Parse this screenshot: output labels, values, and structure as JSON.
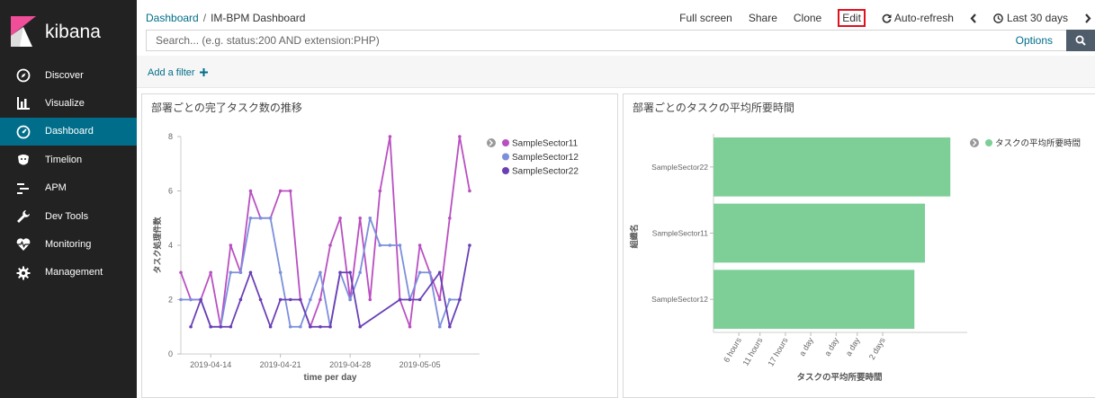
{
  "app": {
    "name": "kibana"
  },
  "sidebar": {
    "items": [
      {
        "label": "Discover",
        "icon": "compass-icon",
        "active": false
      },
      {
        "label": "Visualize",
        "icon": "bar-chart-icon",
        "active": false
      },
      {
        "label": "Dashboard",
        "icon": "dashboard-icon",
        "active": true
      },
      {
        "label": "Timelion",
        "icon": "timelion-icon",
        "active": false
      },
      {
        "label": "APM",
        "icon": "apm-icon",
        "active": false
      },
      {
        "label": "Dev Tools",
        "icon": "wrench-icon",
        "active": false
      },
      {
        "label": "Monitoring",
        "icon": "heartbeat-icon",
        "active": false
      },
      {
        "label": "Management",
        "icon": "gear-icon",
        "active": false
      }
    ]
  },
  "breadcrumb": {
    "root": "Dashboard",
    "separator": "/",
    "current": "IM-BPM Dashboard"
  },
  "topnav": {
    "full_screen": "Full screen",
    "share": "Share",
    "clone": "Clone",
    "edit": "Edit",
    "auto_refresh": "Auto-refresh",
    "time_range": "Last 30 days"
  },
  "search": {
    "placeholder": "Search... (e.g. status:200 AND extension:PHP)",
    "options_label": "Options"
  },
  "filter": {
    "add_label": "Add a filter"
  },
  "colors": {
    "sidebar_bg": "#222222",
    "active_nav": "#006e8a",
    "link": "#006e8a",
    "highlight": "#e0101c",
    "series_sector11": "#b94fc1",
    "series_sector12": "#7b8fdc",
    "series_sector22": "#6a3fb5",
    "bar": "#7dcf97"
  },
  "panels": {
    "left": {
      "title": "部署ごとの完了タスク数の推移"
    },
    "right": {
      "title": "部署ごとのタスクの平均所要時間"
    }
  },
  "chart_data": [
    {
      "type": "line",
      "title": "部署ごとの完了タスク数の推移",
      "xlabel": "time per day",
      "ylabel": "タスク処理件数",
      "x_ticks": [
        "2019-04-14",
        "2019-04-21",
        "2019-04-28",
        "2019-05-05"
      ],
      "x_tick_index": [
        3,
        10,
        17,
        24
      ],
      "x_range_index": [
        0,
        30
      ],
      "ylim": [
        0,
        8
      ],
      "y_ticks": [
        0,
        2,
        4,
        6,
        8
      ],
      "legend_position": "top-right",
      "grid": false,
      "series": [
        {
          "name": "SampleSector11",
          "color": "#b94fc1",
          "points": [
            [
              0,
              3
            ],
            [
              1,
              2
            ],
            [
              2,
              2
            ],
            [
              3,
              3
            ],
            [
              4,
              1
            ],
            [
              5,
              4
            ],
            [
              6,
              3
            ],
            [
              7,
              6
            ],
            [
              8,
              5
            ],
            [
              9,
              5
            ],
            [
              10,
              6
            ],
            [
              11,
              6
            ],
            [
              12,
              2
            ],
            [
              13,
              1
            ],
            [
              14,
              2
            ],
            [
              15,
              4
            ],
            [
              16,
              5
            ],
            [
              17,
              2
            ],
            [
              18,
              5
            ],
            [
              19,
              2
            ],
            [
              20,
              6
            ],
            [
              21,
              8
            ],
            [
              22,
              2
            ],
            [
              23,
              1
            ],
            [
              24,
              4
            ],
            [
              25,
              3
            ],
            [
              26,
              2
            ],
            [
              27,
              5
            ],
            [
              28,
              8
            ],
            [
              29,
              6
            ]
          ]
        },
        {
          "name": "SampleSector12",
          "color": "#7b8fdc",
          "points": [
            [
              0,
              2
            ],
            [
              1,
              2
            ],
            [
              2,
              2
            ],
            [
              3,
              1
            ],
            [
              4,
              1
            ],
            [
              5,
              3
            ],
            [
              6,
              3
            ],
            [
              7,
              5
            ],
            [
              8,
              5
            ],
            [
              9,
              5
            ],
            [
              10,
              3
            ],
            [
              11,
              1
            ],
            [
              12,
              1
            ],
            [
              13,
              2
            ],
            [
              14,
              3
            ],
            [
              15,
              1
            ],
            [
              16,
              3
            ],
            [
              17,
              2
            ],
            [
              18,
              3
            ],
            [
              19,
              5
            ],
            [
              20,
              4
            ],
            [
              21,
              4
            ],
            [
              22,
              4
            ],
            [
              23,
              2
            ],
            [
              24,
              3
            ],
            [
              25,
              3
            ],
            [
              26,
              1
            ],
            [
              27,
              2
            ],
            [
              28,
              2
            ]
          ]
        },
        {
          "name": "SampleSector22",
          "color": "#6a3fb5",
          "points": [
            [
              1,
              1
            ],
            [
              2,
              2
            ],
            [
              3,
              1
            ],
            [
              4,
              1
            ],
            [
              5,
              1
            ],
            [
              6,
              2
            ],
            [
              7,
              3
            ],
            [
              8,
              2
            ],
            [
              9,
              1
            ],
            [
              10,
              2
            ],
            [
              11,
              2
            ],
            [
              12,
              2
            ],
            [
              13,
              1
            ],
            [
              14,
              1
            ],
            [
              15,
              1
            ],
            [
              16,
              3
            ],
            [
              17,
              3
            ],
            [
              18,
              1
            ],
            [
              22,
              2
            ],
            [
              23,
              2
            ],
            [
              24,
              2
            ],
            [
              26,
              3
            ],
            [
              27,
              1
            ],
            [
              28,
              2
            ],
            [
              29,
              4
            ]
          ]
        }
      ]
    },
    {
      "type": "bar",
      "orientation": "horizontal",
      "title": "部署ごとのタスクの平均所要時間",
      "xlabel": "タスクの平均所要時間",
      "ylabel": "組織名",
      "categories": [
        "SampleSector22",
        "SampleSector11",
        "SampleSector12"
      ],
      "values_hours": [
        56,
        50,
        47.5
      ],
      "x_ticks": [
        "6 hours",
        "11 hours",
        "17 hours",
        "a day",
        "a day",
        "a day",
        "2 days"
      ],
      "x_ticks_hours": [
        6,
        11,
        17,
        23,
        29,
        34,
        40
      ],
      "xlim_hours": [
        0,
        60
      ],
      "legend_position": "top-right",
      "series": [
        {
          "name": "タスクの平均所要時間",
          "color": "#7dcf97"
        }
      ]
    }
  ]
}
